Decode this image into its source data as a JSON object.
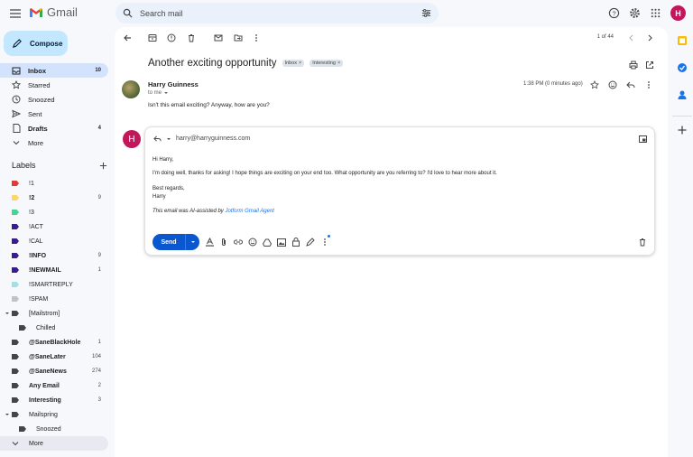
{
  "app": {
    "name": "Gmail"
  },
  "search": {
    "placeholder": "Search mail"
  },
  "account": {
    "initial": "H"
  },
  "compose_label": "Compose",
  "nav": [
    {
      "label": "Inbox",
      "count": "10",
      "active": true,
      "bold": true,
      "icon": "inbox-icon"
    },
    {
      "label": "Starred",
      "count": "",
      "icon": "star-icon"
    },
    {
      "label": "Snoozed",
      "count": "",
      "icon": "clock-icon"
    },
    {
      "label": "Sent",
      "count": "",
      "icon": "send-icon"
    },
    {
      "label": "Drafts",
      "count": "4",
      "bold": true,
      "icon": "draft-icon"
    },
    {
      "label": "More",
      "count": "",
      "icon": "chevron-down-icon"
    }
  ],
  "labels_header": "Labels",
  "labels": [
    {
      "label": "!1",
      "count": "",
      "color": "#e53935"
    },
    {
      "label": "!2",
      "count": "9",
      "color": "#fdd663",
      "bold": true
    },
    {
      "label": "!3",
      "count": "",
      "color": "#43d692"
    },
    {
      "label": "!ACT",
      "count": "",
      "color": "#3c1b8e"
    },
    {
      "label": "!CAL",
      "count": "",
      "color": "#3c1b8e"
    },
    {
      "label": "!INFO",
      "count": "9",
      "color": "#3c1b8e",
      "bold": true
    },
    {
      "label": "!NEWMAIL",
      "count": "1",
      "color": "#3c1b8e",
      "bold": true
    },
    {
      "label": "!SMARTREPLY",
      "count": "",
      "color": "#9fe1e7"
    },
    {
      "label": "!SPAM",
      "count": "",
      "color": "#c2c2c2"
    },
    {
      "label": "[Mailstrom]",
      "count": "",
      "color": "#444746",
      "expand": true
    },
    {
      "label": "Chilled",
      "count": "",
      "color": "#444746",
      "indent": true
    },
    {
      "label": "@SaneBlackHole",
      "count": "1",
      "color": "#444746",
      "bold": true
    },
    {
      "label": "@SaneLater",
      "count": "104",
      "color": "#444746",
      "bold": true
    },
    {
      "label": "@SaneNews",
      "count": "274",
      "color": "#444746",
      "bold": true
    },
    {
      "label": "Any Email",
      "count": "2",
      "color": "#444746",
      "bold": true
    },
    {
      "label": "Interesting",
      "count": "3",
      "color": "#444746",
      "bold": true
    },
    {
      "label": "Mailspring",
      "count": "",
      "color": "#444746",
      "expand": true
    },
    {
      "label": "Snoozed",
      "count": "",
      "color": "#444746",
      "indent": true
    },
    {
      "label": "More",
      "count": "",
      "color": "",
      "more": true
    }
  ],
  "pager": "1 of 44",
  "email": {
    "subject": "Another exciting opportunity",
    "chips": [
      "Inbox",
      "Interesting"
    ],
    "sender": "Harry Guinness",
    "to": "to me",
    "time": "1:38 PM (0 minutes ago)",
    "body": "Isn't this email exciting? Anyway, how are you?"
  },
  "reply": {
    "avatar": "H",
    "to": "harry@harryguinness.com",
    "greeting": "Hi Harry,",
    "paragraph": "I'm doing well, thanks for asking! I hope things are exciting on your end too. What opportunity are you referring to? I'd love to hear more about it.",
    "signoff": "Best regards,",
    "signature": "Harry",
    "ai_prefix": "This email was AI-assisted by ",
    "ai_link": "Jotform Gmail Agent",
    "send_label": "Send"
  }
}
